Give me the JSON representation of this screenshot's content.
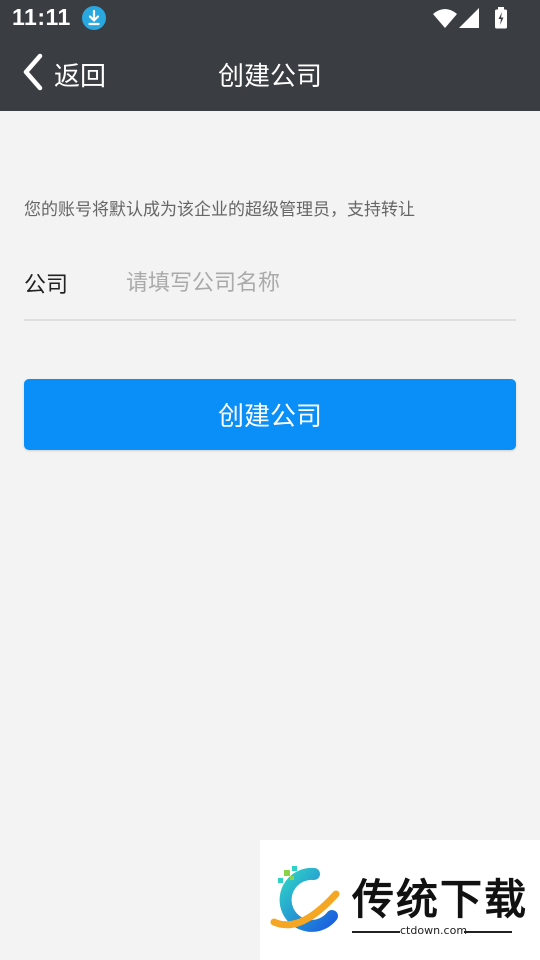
{
  "status_bar": {
    "time": "11:11",
    "icons": [
      "download-icon",
      "wifi-icon",
      "signal-icon",
      "battery-charging-icon"
    ]
  },
  "header": {
    "back_label": "返回",
    "title": "创建公司",
    "background": "#3a3d42"
  },
  "form": {
    "hint": "您的账号将默认成为该企业的超级管理员，支持转让",
    "company_label": "公司",
    "company_value": "",
    "company_placeholder": "请填写公司名称",
    "submit_label": "创建公司",
    "accent": "#0a8ff8"
  },
  "watermark": {
    "title": "传统下载",
    "url": "ctdown.com"
  }
}
